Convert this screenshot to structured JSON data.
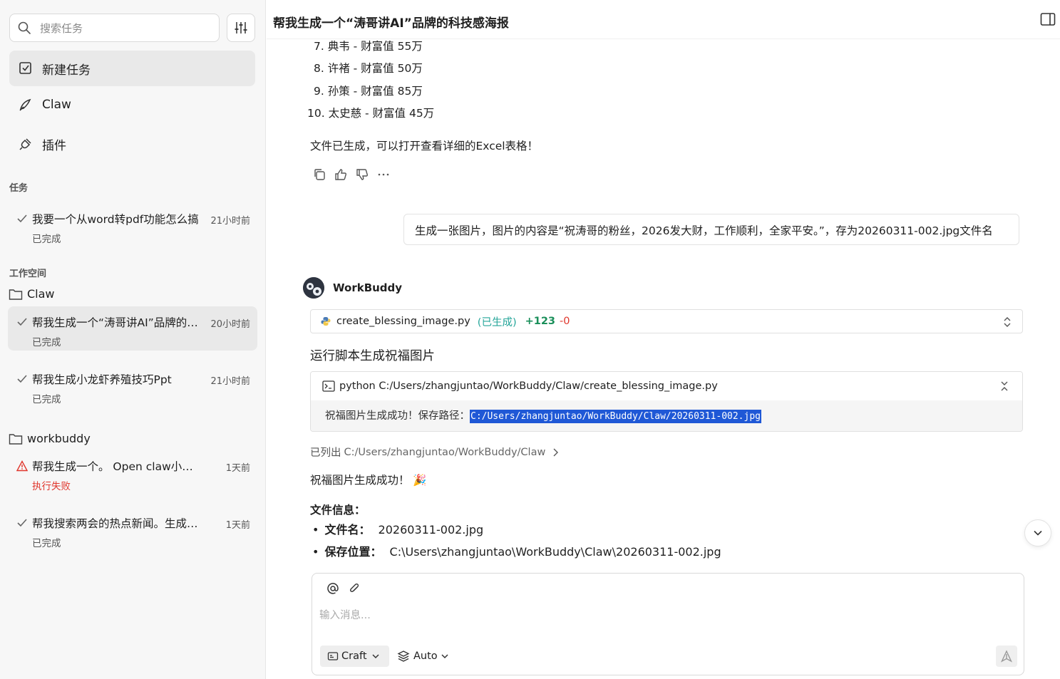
{
  "sidebar": {
    "search_placeholder": "搜索任务",
    "nav": [
      {
        "label": "新建任务"
      },
      {
        "label": "Claw"
      },
      {
        "label": "插件"
      }
    ],
    "tasks_label": "任务",
    "workspace_label": "工作空间",
    "tasks": [
      {
        "title": "我要一个从word转pdf功能怎么搞",
        "time": "21小时前",
        "status": "已完成"
      }
    ],
    "folders": [
      {
        "name": "Claw",
        "items": [
          {
            "title": "帮我生成一个“涛哥讲AI”品牌的…",
            "time": "20小时前",
            "status": "已完成"
          },
          {
            "title": "帮我生成小龙虾养殖技巧Ppt",
            "time": "21小时前",
            "status": "已完成"
          }
        ]
      },
      {
        "name": "workbuddy",
        "items": [
          {
            "title": "帮我生成一个。 Open claw小龙虾…",
            "time": "1天前",
            "status": "执行失败"
          },
          {
            "title": "帮我搜索两会的热点新闻。生成一…",
            "time": "1天前",
            "status": "已完成"
          }
        ]
      }
    ]
  },
  "header": {
    "title": "帮我生成一个“涛哥讲AI”品牌的科技感海报"
  },
  "chat": {
    "list_items": [
      "7. 典韦 - 财富值 55万",
      "8. 许褚 - 财富值 50万",
      "9. 孙策 - 财富值 85万",
      "10. 太史慈 - 财富值 45万"
    ],
    "file_done_msg": "文件已生成，可以打开查看详细的Excel表格！",
    "user_message": "生成一张图片，图片的内容是“祝涛哥的粉丝，2026发大财，工作顺利，全家平安。”，存为20260311-002.jpg文件名",
    "bot_name": "WorkBuddy",
    "file_card": {
      "name": "create_blessing_image.py",
      "state": "(已生成)",
      "added": "+123",
      "removed": "-0"
    },
    "step_title": "运行脚本生成祝福图片",
    "terminal": {
      "command": "python C:/Users/zhangjuntao/WorkBuddy/Claw/create_blessing_image.py",
      "output_prefix": "祝福图片生成成功！保存路径：",
      "output_path": "C:/Users/zhangjuntao/WorkBuddy/Claw/20260311-002.jpg"
    },
    "listed_label": "已列出",
    "listed_path": "C:/Users/zhangjuntao/WorkBuddy/Claw",
    "success_msg": "祝福图片生成成功！ 🎉",
    "info_title": "文件信息：",
    "info": [
      {
        "key": "文件名：",
        "value": "20260311-002.jpg"
      },
      {
        "key": "保存位置：",
        "value": "C:\\Users\\zhangjuntao\\WorkBuddy\\Claw\\20260311-002.jpg"
      }
    ]
  },
  "composer": {
    "placeholder": "输入消息...",
    "mode_label": "Craft",
    "model_label": "Auto"
  },
  "colors": {
    "accent_green": "#26a69a",
    "fail_red": "#e0362c",
    "highlight_blue": "#1f58d6"
  }
}
